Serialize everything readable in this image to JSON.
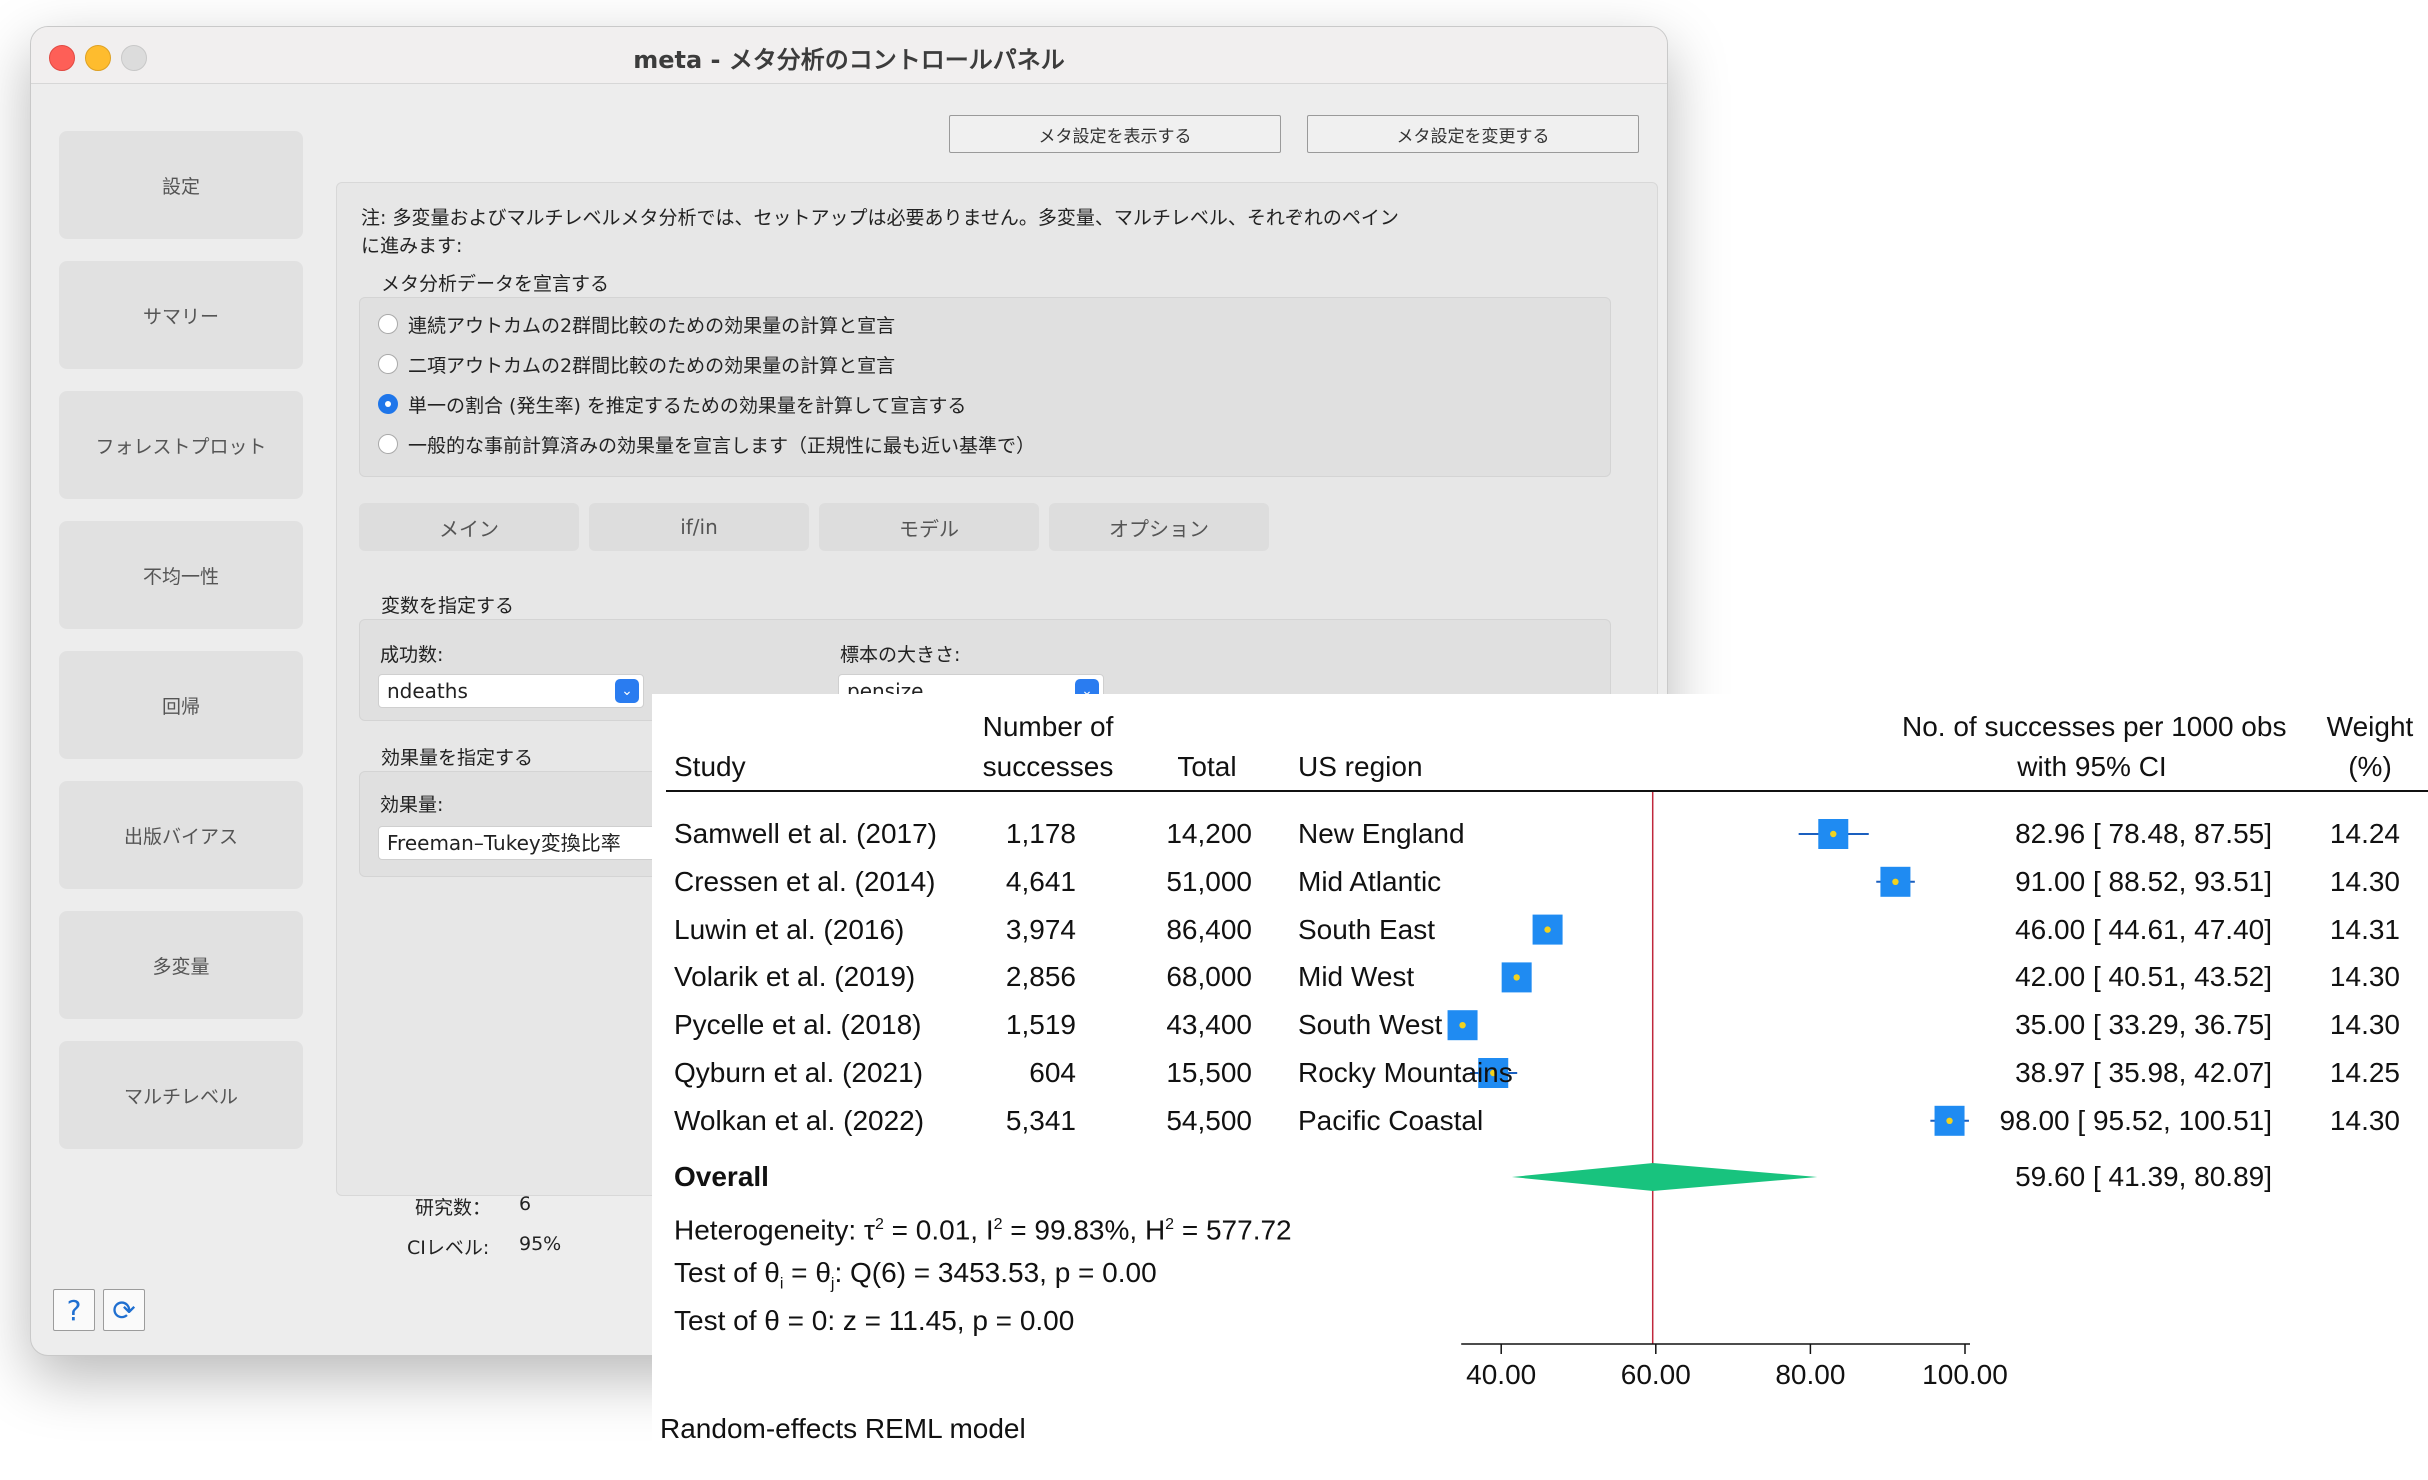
{
  "window": {
    "title": "meta - メタ分析のコントロールパネル"
  },
  "sidebar": {
    "items": [
      {
        "label": "設定"
      },
      {
        "label": "サマリー"
      },
      {
        "label": "フォレストプロット"
      },
      {
        "label": "不均一性"
      },
      {
        "label": "回帰"
      },
      {
        "label": "出版バイアス"
      },
      {
        "label": "多変量"
      },
      {
        "label": "マルチレベル"
      }
    ]
  },
  "toolbar": {
    "show_settings": "メタ設定を表示する",
    "change_settings": "メタ設定を変更する"
  },
  "main": {
    "note_line1": "注: 多変量およびマルチレベルメタ分析では、セットアップは必要ありません。多変量、マルチレベル、それぞれのペイン",
    "note_line2": "に進みます:",
    "declare_label": "メタ分析データを宣言する",
    "radio_options": [
      {
        "label": "連続アウトカムの2群間比較のための効果量の計算と宣言",
        "selected": false
      },
      {
        "label": "二項アウトカムの2群間比較のための効果量の計算と宣言",
        "selected": false
      },
      {
        "label": "単一の割合 (発生率) を推定するための効果量を計算して宣言する",
        "selected": true
      },
      {
        "label": "一般的な事前計算済みの効果量を宣言します（正規性に最も近い基準で）",
        "selected": false
      }
    ],
    "tabs": [
      {
        "label": "メイン"
      },
      {
        "label": "if/in"
      },
      {
        "label": "モデル"
      },
      {
        "label": "オプション"
      }
    ],
    "variables_label": "変数を指定する",
    "successes_label": "成功数:",
    "successes_value": "ndeaths",
    "sample_size_label": "標本の大きさ:",
    "sample_size_value": "pensize",
    "effect_section_label": "効果量を指定する",
    "effect_label": "効果量:",
    "effect_value": "Freeman–Tukey変換比率"
  },
  "footer": {
    "studies_label": "研究数：",
    "studies_value": "6",
    "ci_label": "CIレベル:",
    "ci_value": "95%"
  },
  "colors": {
    "accent": "#1f76ea",
    "marker_fill": "#1f8bf2",
    "marker_dot": "#f2d21d",
    "diamond": "#18c37e",
    "ref_line": "#c0283c"
  },
  "chart_data": {
    "type": "forest",
    "headers": {
      "study": "Study",
      "successes_line1": "Number of",
      "successes_line2": "successes",
      "total": "Total",
      "region": "US region",
      "effect_line1": "No. of successes per 1000 obs",
      "effect_line2": "with 95% CI",
      "weight_line1": "Weight",
      "weight_line2": "(%)"
    },
    "studies": [
      {
        "study": "Samwell et al. (2017)",
        "successes": "1,178",
        "total": "14,200",
        "region": "New England",
        "est": 82.96,
        "lo": 78.48,
        "hi": 87.55,
        "ci_text": "82.96 [ 78.48,    87.55]",
        "weight": "14.24"
      },
      {
        "study": "Cressen et al. (2014)",
        "successes": "4,641",
        "total": "51,000",
        "region": "Mid Atlantic",
        "est": 91.0,
        "lo": 88.52,
        "hi": 93.51,
        "ci_text": "91.00 [ 88.52,    93.51]",
        "weight": "14.30"
      },
      {
        "study": "Luwin et al. (2016)",
        "successes": "3,974",
        "total": "86,400",
        "region": "South East",
        "est": 46.0,
        "lo": 44.61,
        "hi": 47.4,
        "ci_text": "46.00 [ 44.61,    47.40]",
        "weight": "14.31"
      },
      {
        "study": "Volarik et al. (2019)",
        "successes": "2,856",
        "total": "68,000",
        "region": "Mid West",
        "est": 42.0,
        "lo": 40.51,
        "hi": 43.52,
        "ci_text": "42.00 [ 40.51,    43.52]",
        "weight": "14.30"
      },
      {
        "study": "Pycelle et al. (2018)",
        "successes": "1,519",
        "total": "43,400",
        "region": "South West",
        "est": 35.0,
        "lo": 33.29,
        "hi": 36.75,
        "ci_text": "35.00 [ 33.29,    36.75]",
        "weight": "14.30"
      },
      {
        "study": "Qyburn et al. (2021)",
        "successes": "604",
        "total": "15,500",
        "region": "Rocky Mountains",
        "est": 38.97,
        "lo": 35.98,
        "hi": 42.07,
        "ci_text": "38.97 [ 35.98,    42.07]",
        "weight": "14.25"
      },
      {
        "study": "Wolkan et al. (2022)",
        "successes": "5,341",
        "total": "54,500",
        "region": "Pacific Coastal",
        "est": 98.0,
        "lo": 95.52,
        "hi": 100.51,
        "ci_text": "98.00 [ 95.52,  100.51]",
        "weight": "14.30"
      }
    ],
    "overall": {
      "label": "Overall",
      "est": 59.6,
      "lo": 41.39,
      "hi": 80.89,
      "ci_text": "59.60 [ 41.39,    80.89]"
    },
    "reference_line": 59.6,
    "x_ticks": [
      "40.00",
      "60.00",
      "80.00",
      "100.00"
    ],
    "x_tick_values": [
      40,
      60,
      80,
      100
    ],
    "xlim": [
      40,
      100
    ],
    "model_note": "Random-effects REML model"
  }
}
